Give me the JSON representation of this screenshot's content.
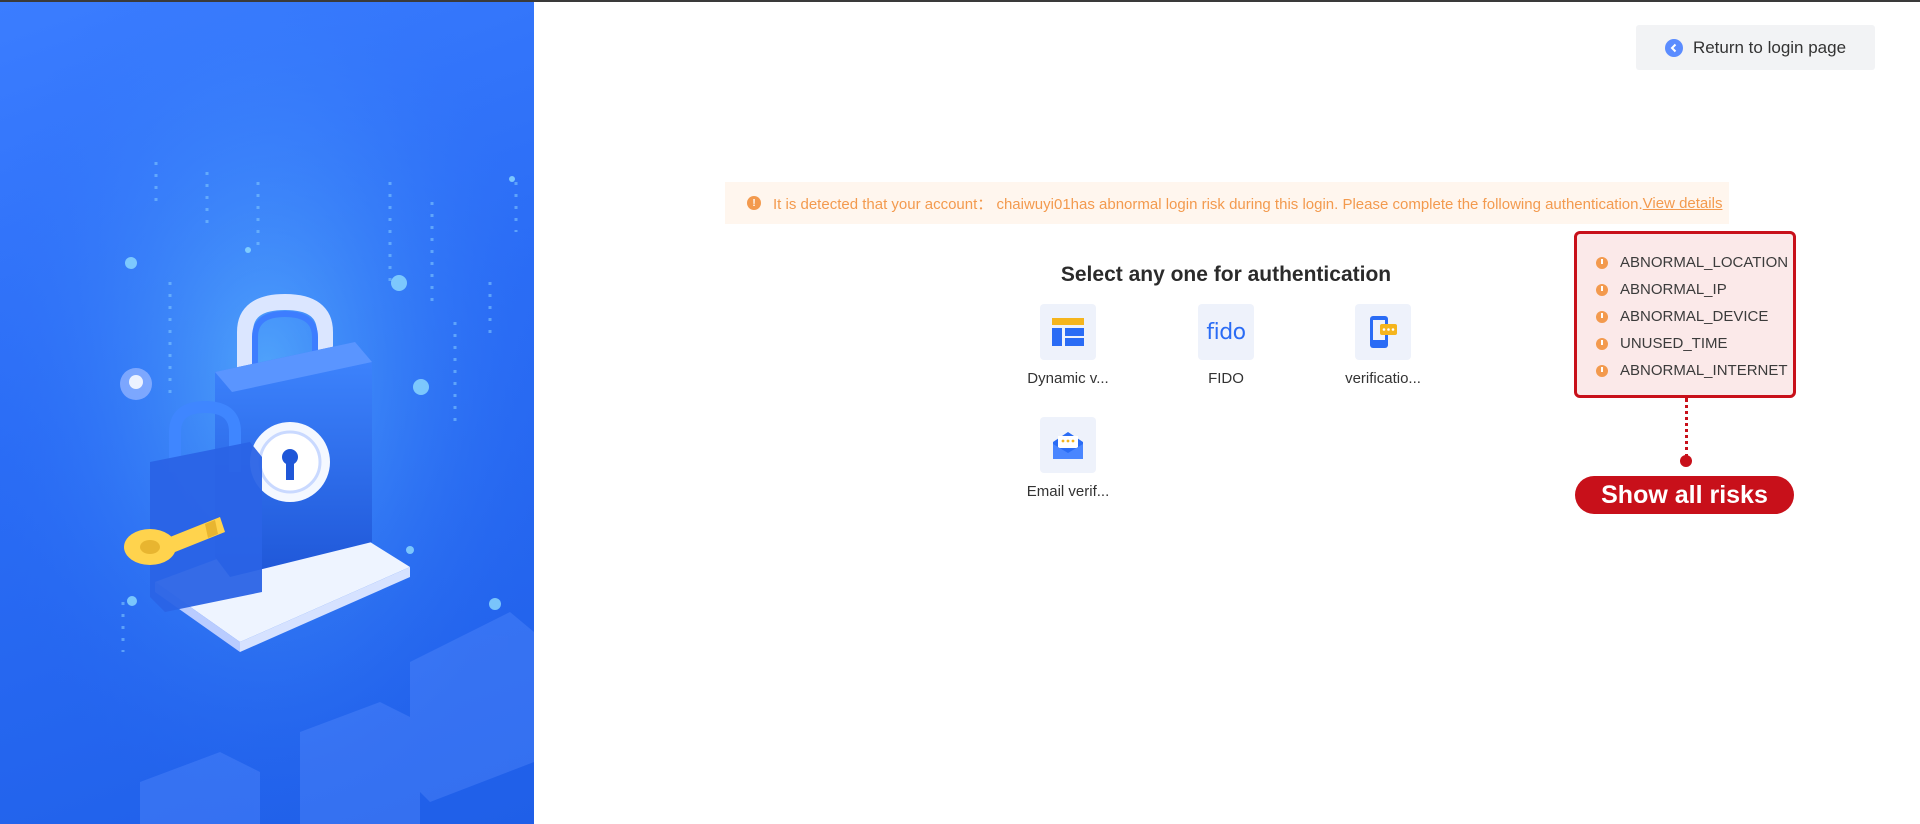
{
  "header": {
    "return_label": "Return to login page"
  },
  "alert": {
    "message": "It is detected that your account： chaiwuyi01has abnormal login risk during this login. Please complete the following authentication.",
    "link_label": "View details"
  },
  "auth": {
    "title": "Select any one for authentication",
    "methods": [
      {
        "label": "Dynamic v...",
        "icon": "dynamic-verification-icon"
      },
      {
        "label": "FIDO",
        "icon": "fido-icon",
        "icon_text": "fido"
      },
      {
        "label": "verificatio...",
        "icon": "sms-verification-icon"
      },
      {
        "label": "Email verif...",
        "icon": "email-verification-icon"
      }
    ]
  },
  "risks": {
    "items": [
      "ABNORMAL_LOCATION",
      "ABNORMAL_IP",
      "ABNORMAL_DEVICE",
      "UNUSED_TIME",
      "ABNORMAL_INTERNET"
    ],
    "button_label": "Show all risks"
  },
  "colors": {
    "brand_blue": "#2a6cf5",
    "warning_orange": "#f39a4e",
    "annotation_red": "#c8101a"
  }
}
